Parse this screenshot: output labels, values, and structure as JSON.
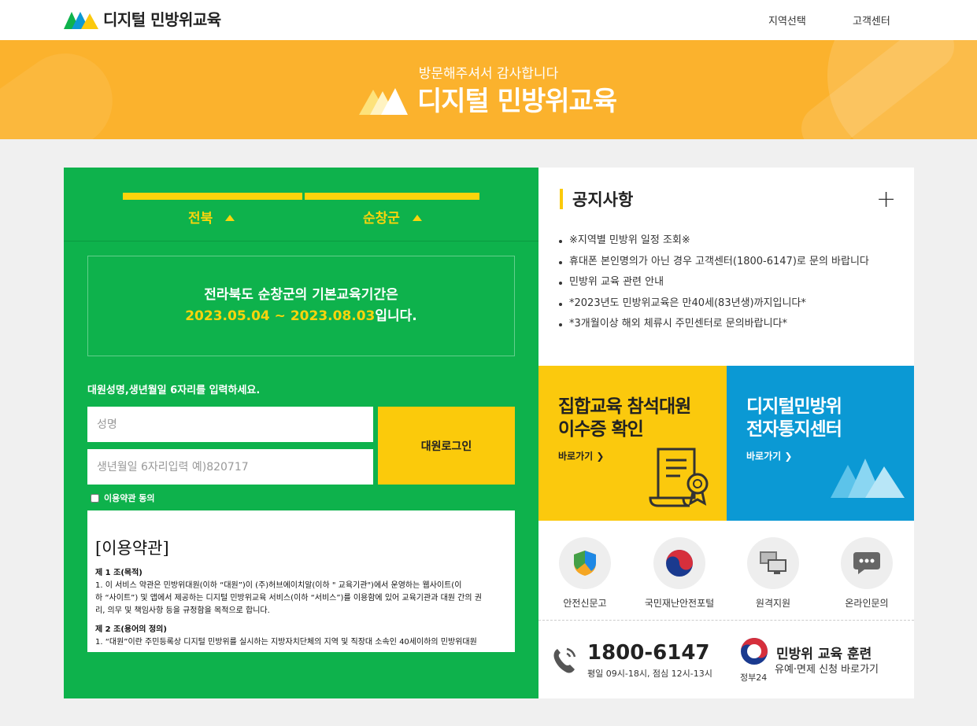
{
  "header": {
    "brand": "디지털 민방위교육",
    "nav": [
      "지역선택",
      "고객센터"
    ]
  },
  "banner": {
    "subtitle": "방문해주셔서 감사합니다",
    "title": "디지털 민방위교육"
  },
  "region": {
    "province": "전북",
    "district": "순창군"
  },
  "period": {
    "line1": "전라북도 순창군의 기본교육기간은",
    "dates": "2023.05.04 ~ 2023.08.03",
    "suffix": "입니다."
  },
  "login": {
    "prompt": "대원성명,생년월일 6자리를 입력하세요.",
    "name_placeholder": "성명",
    "birth_placeholder": "생년월일 6자리입력 예)820717",
    "button": "대원로그인",
    "agree_label": "이용약관 동의"
  },
  "terms": {
    "title": "[이용약관]",
    "lines": [
      "제 1 조(목적)",
      "1. 이 서비스 약관은 민방위대원(이하 “대원”)이 (주)허브에이치알(이하 \" 교육기관\")에서 운영하는 웹사이트(이",
      "하 “사이트”) 및 앱에서 제공하는 디지털 민방위교육 서비스(이하 “서비스”)를 이용함에 있어 교육기관과 대원 간의 권",
      "리, 의무 및 책임사항 등을 규정함을 목적으로 합니다.",
      "",
      "제 2 조(용어의 정의)",
      "1. “대원”이란 주민등록상 디지털 민방위를 실시하는 지방자치단체의 지역 및 직장대 소속인 40세이하의 민방위대원"
    ]
  },
  "notice": {
    "title": "공지사항",
    "more": "+",
    "items": [
      "※지역별 민방위 일정 조회※",
      "휴대폰 본인명의가 아닌 경우 고객센터(1800-6147)로 문의 바랍니다",
      "민방위 교육 관련 안내",
      "*2023년도 민방위교육은 만40세(83년생)까지입니다*",
      "*3개월이상 해외 체류시 주민센터로 문의바랍니다*"
    ]
  },
  "cards": [
    {
      "title1": "집합교육 참석대원",
      "title2": "이수증 확인",
      "link": "바로가기 ❯",
      "color": "#fbc90d"
    },
    {
      "title1": "디지털민방위",
      "title2": "전자통지센터",
      "link": "바로가기 ❯",
      "color": "#0b99d4"
    }
  ],
  "quick_links": [
    {
      "label": "안전신문고",
      "icon": "shield-icon"
    },
    {
      "label": "국민재난안전포털",
      "icon": "taegeuk-icon"
    },
    {
      "label": "원격지원",
      "icon": "monitor-icon"
    },
    {
      "label": "온라인문의",
      "icon": "chat-icon"
    }
  ],
  "contact": {
    "phone": "1800-6147",
    "hours": "평일 09시-18시, 점심 12시-13시",
    "gov_title": "민방위 교육 훈련",
    "gov_sub": "유예·면제 신청 바로가기",
    "gov_label": "정부24"
  },
  "colors": {
    "green": "#0eb24c",
    "yellow": "#fbc90d",
    "blue": "#0b99d4",
    "banner": "#fbb22d"
  }
}
